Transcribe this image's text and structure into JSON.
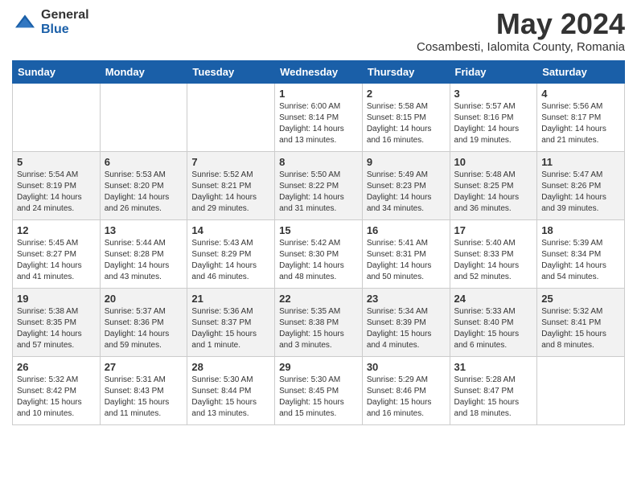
{
  "header": {
    "logo": {
      "general": "General",
      "blue": "Blue"
    },
    "title": "May 2024",
    "location": "Cosambesti, Ialomita County, Romania"
  },
  "days_of_week": [
    "Sunday",
    "Monday",
    "Tuesday",
    "Wednesday",
    "Thursday",
    "Friday",
    "Saturday"
  ],
  "weeks": [
    [
      {
        "day": "",
        "detail": ""
      },
      {
        "day": "",
        "detail": ""
      },
      {
        "day": "",
        "detail": ""
      },
      {
        "day": "1",
        "detail": "Sunrise: 6:00 AM\nSunset: 8:14 PM\nDaylight: 14 hours\nand 13 minutes."
      },
      {
        "day": "2",
        "detail": "Sunrise: 5:58 AM\nSunset: 8:15 PM\nDaylight: 14 hours\nand 16 minutes."
      },
      {
        "day": "3",
        "detail": "Sunrise: 5:57 AM\nSunset: 8:16 PM\nDaylight: 14 hours\nand 19 minutes."
      },
      {
        "day": "4",
        "detail": "Sunrise: 5:56 AM\nSunset: 8:17 PM\nDaylight: 14 hours\nand 21 minutes."
      }
    ],
    [
      {
        "day": "5",
        "detail": "Sunrise: 5:54 AM\nSunset: 8:19 PM\nDaylight: 14 hours\nand 24 minutes."
      },
      {
        "day": "6",
        "detail": "Sunrise: 5:53 AM\nSunset: 8:20 PM\nDaylight: 14 hours\nand 26 minutes."
      },
      {
        "day": "7",
        "detail": "Sunrise: 5:52 AM\nSunset: 8:21 PM\nDaylight: 14 hours\nand 29 minutes."
      },
      {
        "day": "8",
        "detail": "Sunrise: 5:50 AM\nSunset: 8:22 PM\nDaylight: 14 hours\nand 31 minutes."
      },
      {
        "day": "9",
        "detail": "Sunrise: 5:49 AM\nSunset: 8:23 PM\nDaylight: 14 hours\nand 34 minutes."
      },
      {
        "day": "10",
        "detail": "Sunrise: 5:48 AM\nSunset: 8:25 PM\nDaylight: 14 hours\nand 36 minutes."
      },
      {
        "day": "11",
        "detail": "Sunrise: 5:47 AM\nSunset: 8:26 PM\nDaylight: 14 hours\nand 39 minutes."
      }
    ],
    [
      {
        "day": "12",
        "detail": "Sunrise: 5:45 AM\nSunset: 8:27 PM\nDaylight: 14 hours\nand 41 minutes."
      },
      {
        "day": "13",
        "detail": "Sunrise: 5:44 AM\nSunset: 8:28 PM\nDaylight: 14 hours\nand 43 minutes."
      },
      {
        "day": "14",
        "detail": "Sunrise: 5:43 AM\nSunset: 8:29 PM\nDaylight: 14 hours\nand 46 minutes."
      },
      {
        "day": "15",
        "detail": "Sunrise: 5:42 AM\nSunset: 8:30 PM\nDaylight: 14 hours\nand 48 minutes."
      },
      {
        "day": "16",
        "detail": "Sunrise: 5:41 AM\nSunset: 8:31 PM\nDaylight: 14 hours\nand 50 minutes."
      },
      {
        "day": "17",
        "detail": "Sunrise: 5:40 AM\nSunset: 8:33 PM\nDaylight: 14 hours\nand 52 minutes."
      },
      {
        "day": "18",
        "detail": "Sunrise: 5:39 AM\nSunset: 8:34 PM\nDaylight: 14 hours\nand 54 minutes."
      }
    ],
    [
      {
        "day": "19",
        "detail": "Sunrise: 5:38 AM\nSunset: 8:35 PM\nDaylight: 14 hours\nand 57 minutes."
      },
      {
        "day": "20",
        "detail": "Sunrise: 5:37 AM\nSunset: 8:36 PM\nDaylight: 14 hours\nand 59 minutes."
      },
      {
        "day": "21",
        "detail": "Sunrise: 5:36 AM\nSunset: 8:37 PM\nDaylight: 15 hours\nand 1 minute."
      },
      {
        "day": "22",
        "detail": "Sunrise: 5:35 AM\nSunset: 8:38 PM\nDaylight: 15 hours\nand 3 minutes."
      },
      {
        "day": "23",
        "detail": "Sunrise: 5:34 AM\nSunset: 8:39 PM\nDaylight: 15 hours\nand 4 minutes."
      },
      {
        "day": "24",
        "detail": "Sunrise: 5:33 AM\nSunset: 8:40 PM\nDaylight: 15 hours\nand 6 minutes."
      },
      {
        "day": "25",
        "detail": "Sunrise: 5:32 AM\nSunset: 8:41 PM\nDaylight: 15 hours\nand 8 minutes."
      }
    ],
    [
      {
        "day": "26",
        "detail": "Sunrise: 5:32 AM\nSunset: 8:42 PM\nDaylight: 15 hours\nand 10 minutes."
      },
      {
        "day": "27",
        "detail": "Sunrise: 5:31 AM\nSunset: 8:43 PM\nDaylight: 15 hours\nand 11 minutes."
      },
      {
        "day": "28",
        "detail": "Sunrise: 5:30 AM\nSunset: 8:44 PM\nDaylight: 15 hours\nand 13 minutes."
      },
      {
        "day": "29",
        "detail": "Sunrise: 5:30 AM\nSunset: 8:45 PM\nDaylight: 15 hours\nand 15 minutes."
      },
      {
        "day": "30",
        "detail": "Sunrise: 5:29 AM\nSunset: 8:46 PM\nDaylight: 15 hours\nand 16 minutes."
      },
      {
        "day": "31",
        "detail": "Sunrise: 5:28 AM\nSunset: 8:47 PM\nDaylight: 15 hours\nand 18 minutes."
      },
      {
        "day": "",
        "detail": ""
      }
    ]
  ]
}
